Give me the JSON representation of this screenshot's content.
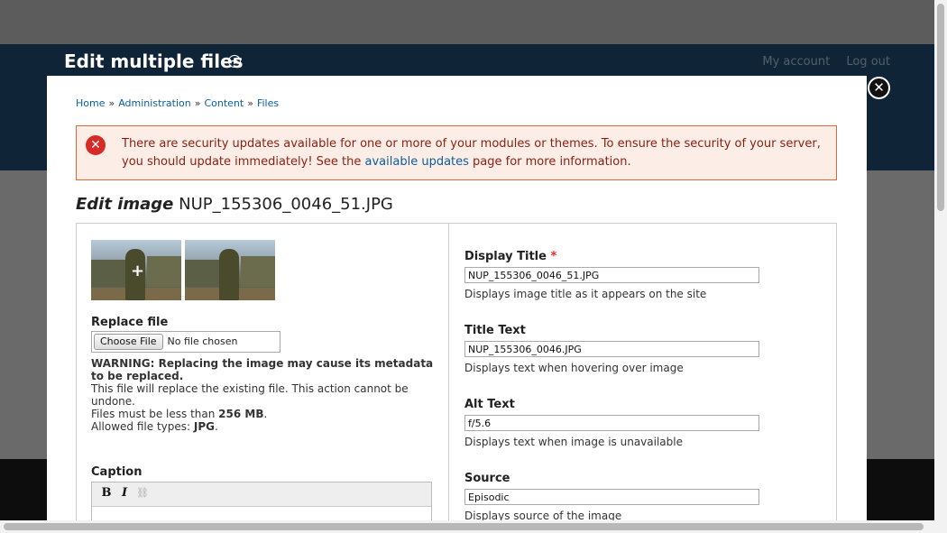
{
  "background": {
    "title": "Edit multiple files",
    "links": [
      "My account",
      "Log out"
    ]
  },
  "breadcrumb": [
    "Home",
    "Administration",
    "Content",
    "Files"
  ],
  "alert": {
    "text_before": "There are security updates available for one or more of your modules or themes. To ensure the security of your server, you should update immediately! See the ",
    "link": "available updates",
    "text_after": " page for more information."
  },
  "page": {
    "title_prefix": "Edit image",
    "title_file": "NUP_155306_0046_51.JPG"
  },
  "left": {
    "replace_label": "Replace file",
    "choose_button": "Choose File",
    "no_file": "No file chosen",
    "warning_bold": "WARNING: Replacing the image may cause its metadata to be replaced.",
    "warning_line1": "This file will replace the existing file. This action cannot be undone.",
    "size_prefix": "Files must be less than ",
    "size_value": "256 MB",
    "types_prefix": "Allowed file types: ",
    "types_value": "JPG",
    "caption_label": "Caption"
  },
  "right": {
    "fields": [
      {
        "label": "Display Title",
        "required": "*",
        "value": "NUP_155306_0046_51.JPG",
        "description": "Displays image title as it appears on the site"
      },
      {
        "label": "Title Text",
        "value": "NUP_155306_0046.JPG",
        "description": "Displays text when hovering over image"
      },
      {
        "label": "Alt Text",
        "value": "f/5.6",
        "description": "Displays text when image is unavailable"
      },
      {
        "label": "Source",
        "value": "Episodic",
        "description": "Displays source of the image"
      }
    ]
  },
  "icons": {
    "close": "close-icon",
    "alert": "error-icon",
    "add": "plus-circle-icon"
  }
}
